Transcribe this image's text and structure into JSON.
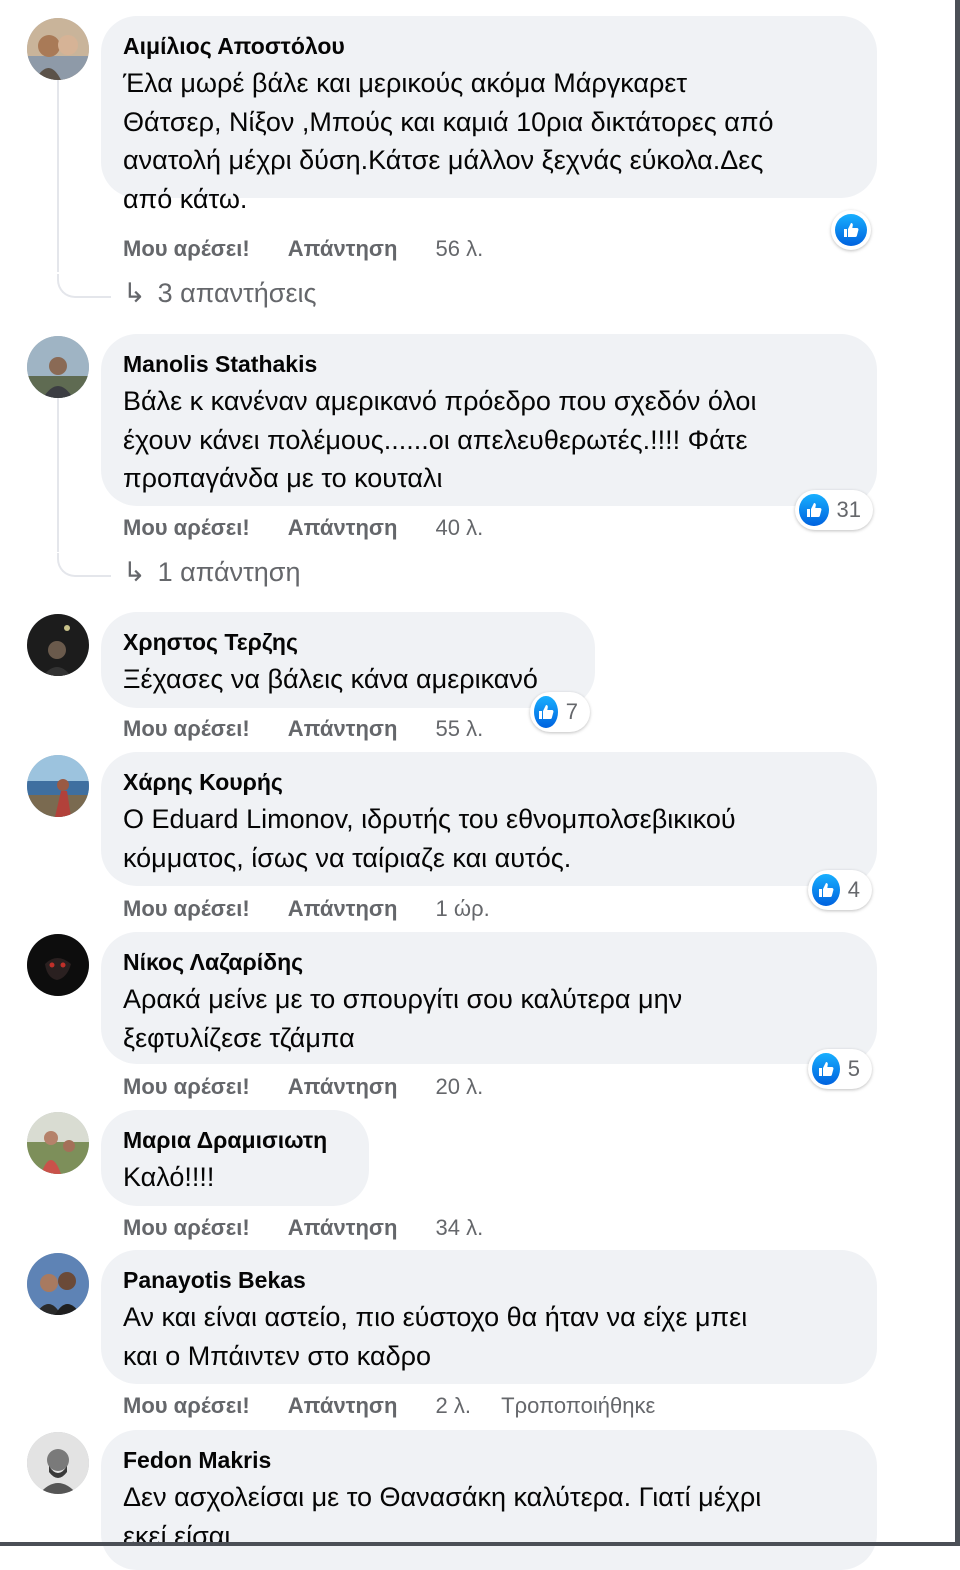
{
  "comments": [
    {
      "author": "Αιμίλιος Αποστόλου",
      "text": "Έλα μωρέ βάλε και μερικούς ακόμα Μάργκαρετ\nΘάτσερ, Νίξον ,Μπούς και καμιά 10ρια δικτάτορες από\nανατολή μέχρι δύση.Κάτσε μάλλον ξεχνάς εύκολα.Δες\nαπό κάτω.",
      "like": "Μου αρέσει!",
      "reply": "Απάντηση",
      "time": "56 λ.",
      "reaction_count": "",
      "replies": "3 απαντήσεις"
    },
    {
      "author": "Manolis Stathakis",
      "text": "Βάλε κ κανέναν αμερικανό πρόεδρο που σχεδόν όλοι\nέχουν κάνει πολέμους......οι απελευθερωτές.!!!! Φάτε\nπροπαγάνδα με το κουταλι",
      "like": "Μου αρέσει!",
      "reply": "Απάντηση",
      "time": "40 λ.",
      "reaction_count": "31",
      "replies": "1 απάντηση"
    },
    {
      "author": "Χρηστος Τερζης",
      "text": "Ξέχασες να βάλεις κάνα αμερικανό",
      "like": "Μου αρέσει!",
      "reply": "Απάντηση",
      "time": "55 λ.",
      "reaction_count": "7"
    },
    {
      "author": "Χάρης Κουρής",
      "text": "Ο Eduard Limonov, ιδρυτής του εθνομπολσεβικικού\nκόμματος, ίσως να ταίριαζε και αυτός.",
      "like": "Μου αρέσει!",
      "reply": "Απάντηση",
      "time": "1 ώρ.",
      "reaction_count": "4"
    },
    {
      "author": "Νίκος Λαζαρίδης",
      "text": "Αρακά μείνε με το σπουργίτι σου καλύτερα μην\nξεφτυλίζεσε τζάμπα",
      "like": "Μου αρέσει!",
      "reply": "Απάντηση",
      "time": "20 λ.",
      "reaction_count": "5"
    },
    {
      "author": "Μαρια Δραμισιωτη",
      "text": "Καλό!!!!",
      "like": "Μου αρέσει!",
      "reply": "Απάντηση",
      "time": "34 λ."
    },
    {
      "author": "Panayotis Bekas",
      "text": "Αν και είναι αστείο, πιο εύστοχο θα ήταν να είχε μπει\nκαι ο Μπάιντεν στο καδρο",
      "like": "Μου αρέσει!",
      "reply": "Απάντηση",
      "time": "2 λ.",
      "edited": "Τροποποιήθηκε"
    },
    {
      "author": "Fedon Makris",
      "text": "Δεν ασχολείσαι με το Θανασάκη καλύτερα. Γιατί μέχρι\nεκεί είσαι."
    }
  ],
  "colors": {
    "bubble": "#f0f2f5",
    "secondary_text": "#65676b",
    "like_blue": "#1877f2"
  }
}
